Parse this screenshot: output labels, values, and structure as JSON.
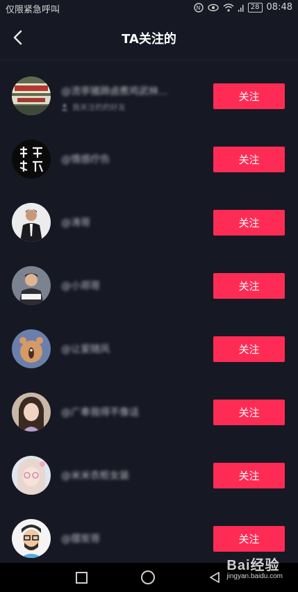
{
  "status_bar": {
    "carrier_text": "仅限紧急呼叫",
    "battery": "28",
    "time": "08:48"
  },
  "header": {
    "title": "TA关注的"
  },
  "users": [
    {
      "name": "@流亭猪蹄卤煮鸡武林...",
      "subtitle": "我关注的的好友"
    },
    {
      "name": "@情感疗伤"
    },
    {
      "name": "@涛哥"
    },
    {
      "name": "@小郑哥"
    },
    {
      "name": "@让爱随风"
    },
    {
      "name": "@广奉我得不像话"
    },
    {
      "name": "@米米衣柜女装"
    },
    {
      "name": "@摆炭哥"
    }
  ],
  "follow_label": "关注",
  "watermark": {
    "brand": "Bai经验",
    "url": "jingyan.baidu.com"
  },
  "colors": {
    "background": "#161823",
    "follow_button": "#fe2c55"
  }
}
